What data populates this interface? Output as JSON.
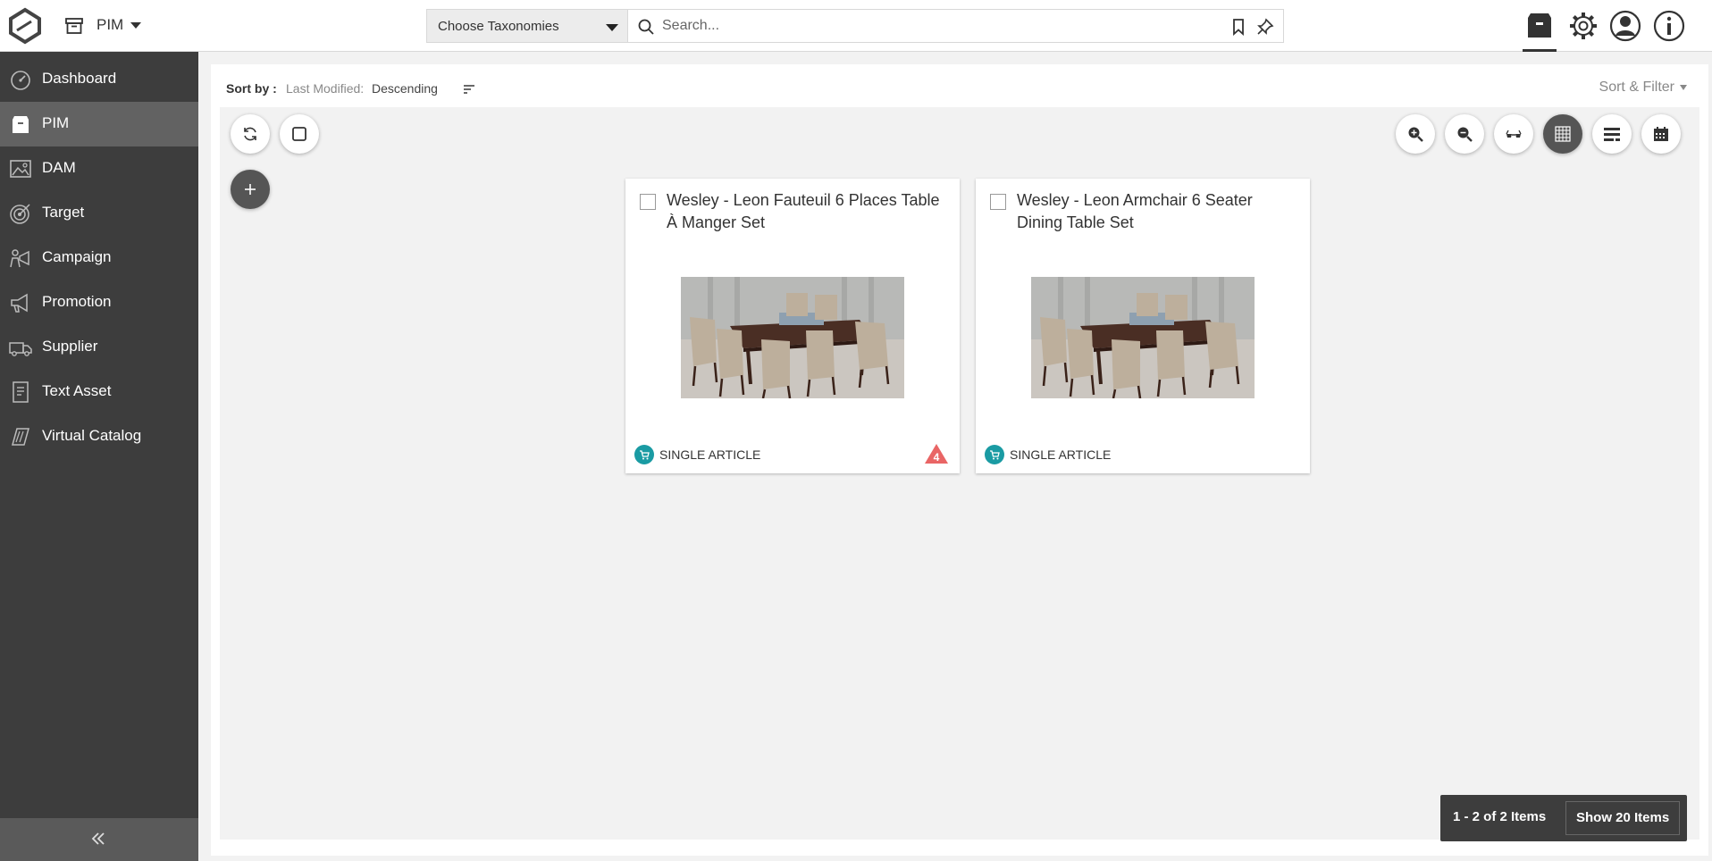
{
  "header": {
    "module_label": "PIM",
    "taxonomy_select_label": "Choose Taxonomies",
    "search_placeholder": "Search..."
  },
  "sidebar": {
    "items": [
      {
        "label": "Dashboard",
        "icon": "dashboard-icon"
      },
      {
        "label": "PIM",
        "icon": "pim-icon",
        "active": true
      },
      {
        "label": "DAM",
        "icon": "image-icon"
      },
      {
        "label": "Target",
        "icon": "target-icon"
      },
      {
        "label": "Campaign",
        "icon": "campaign-icon"
      },
      {
        "label": "Promotion",
        "icon": "megaphone-icon"
      },
      {
        "label": "Supplier",
        "icon": "truck-icon"
      },
      {
        "label": "Text Asset",
        "icon": "document-icon"
      },
      {
        "label": "Virtual Catalog",
        "icon": "catalog-icon"
      }
    ]
  },
  "sort": {
    "label": "Sort by :",
    "field": "Last Modified:",
    "order": "Descending",
    "filter_label": "Sort & Filter"
  },
  "cards": [
    {
      "title": "Wesley - Leon Fauteuil 6 Places Table À Manger Set",
      "type": "SINGLE ARTICLE",
      "warning_count": "4"
    },
    {
      "title": "Wesley - Leon Armchair 6 Seater Dining Table Set",
      "type": "SINGLE ARTICLE"
    }
  ],
  "pagination": {
    "count_text": "1 - 2 of 2 Items",
    "show_text": "Show 20 Items"
  },
  "colors": {
    "sidebar_bg": "#3d3d3d",
    "sidebar_active": "#626262",
    "accent_teal": "#1a9ba3",
    "warning_red": "#e96565"
  }
}
